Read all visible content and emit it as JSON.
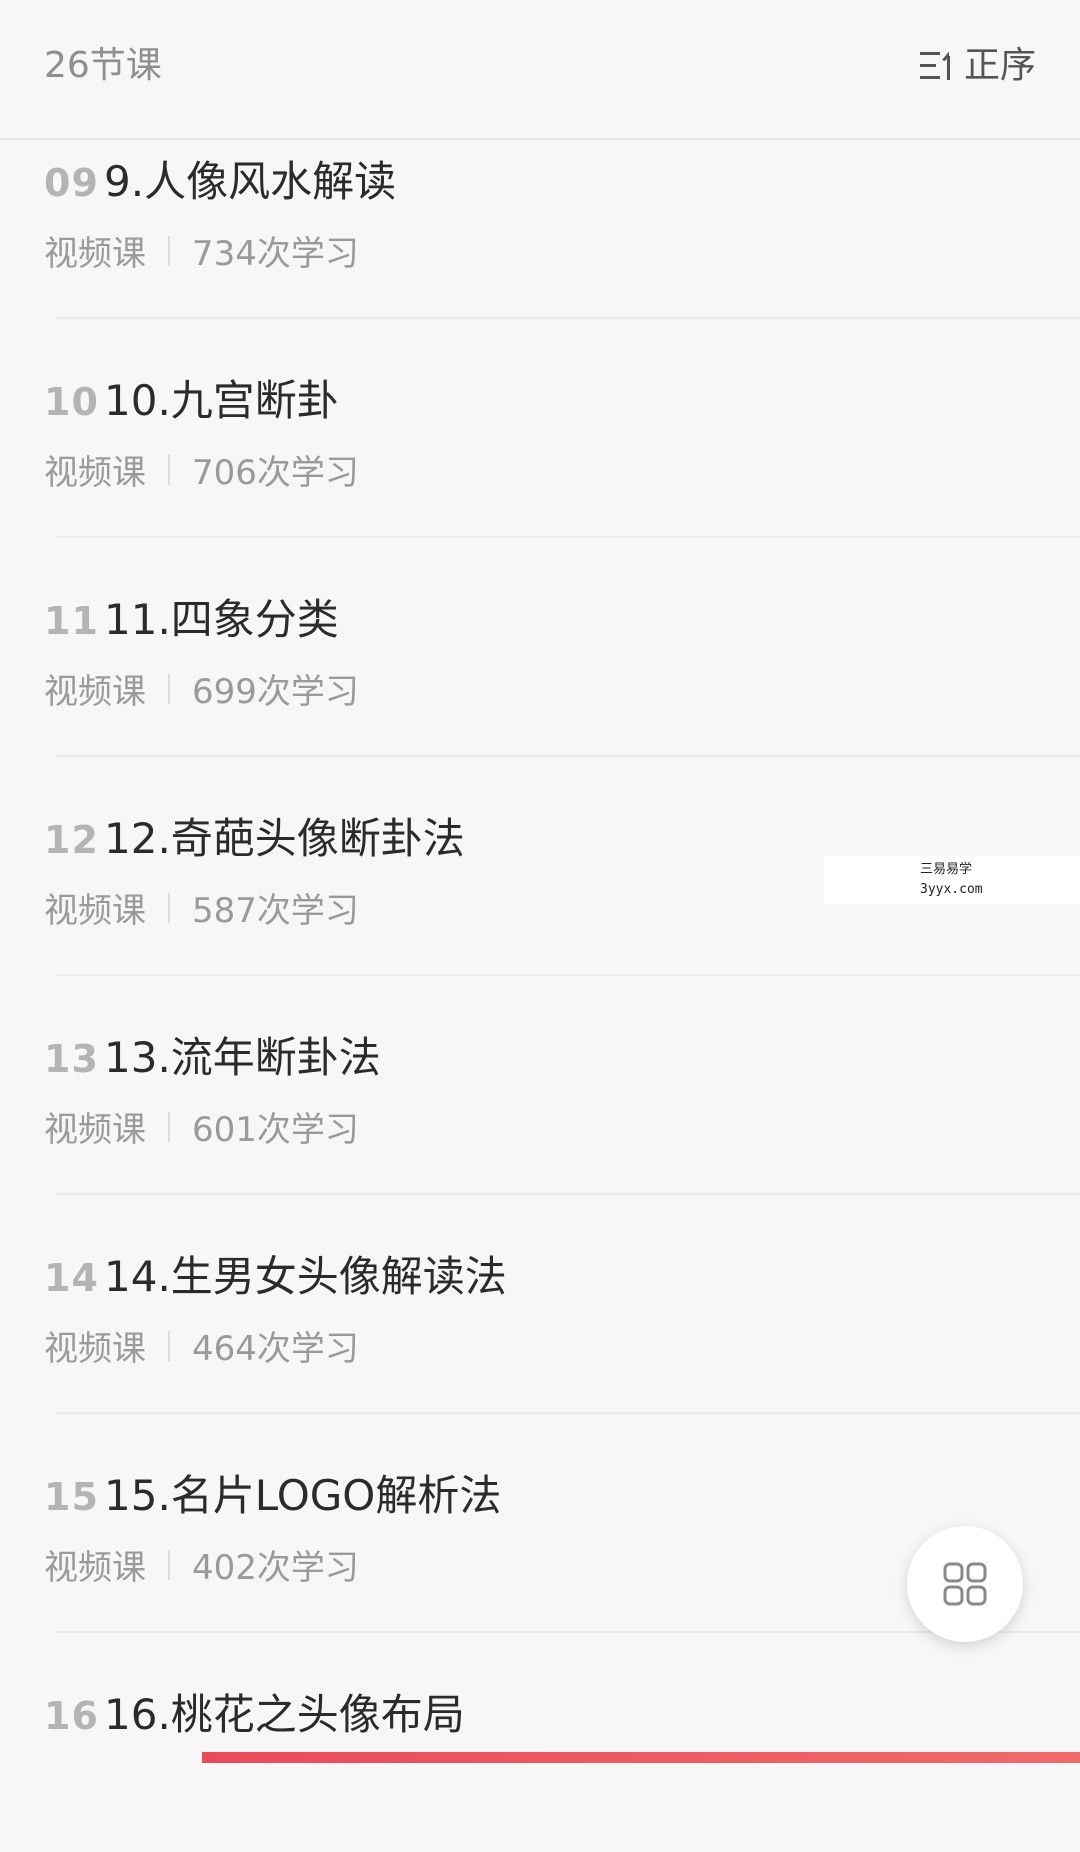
{
  "header": {
    "lesson_count": "26节课",
    "sort_label": "正序",
    "sort_icon": "sort-order-icon"
  },
  "lessons": [
    {
      "num": "09",
      "title": "9.人像风水解读",
      "type": "视频课",
      "views": "734次学习"
    },
    {
      "num": "10",
      "title": "10.九宫断卦",
      "type": "视频课",
      "views": "706次学习"
    },
    {
      "num": "11",
      "title": "11.四象分类",
      "type": "视频课",
      "views": "699次学习"
    },
    {
      "num": "12",
      "title": "12.奇葩头像断卦法",
      "type": "视频课",
      "views": "587次学习"
    },
    {
      "num": "13",
      "title": "13.流年断卦法",
      "type": "视频课",
      "views": "601次学习"
    },
    {
      "num": "14",
      "title": "14.生男女头像解读法",
      "type": "视频课",
      "views": "464次学习"
    },
    {
      "num": "15",
      "title": "15.名片LOGO解析法",
      "type": "视频课",
      "views": "402次学习"
    },
    {
      "num": "16",
      "title": "16.桃花之头像布局",
      "type": "视频课",
      "views": ""
    }
  ],
  "watermark": {
    "line1": "三易易学",
    "line2": "3yyx.com"
  },
  "fab": {
    "icon": "grid-icon"
  },
  "colors": {
    "background": "#f7f7f7",
    "accent_bar": "#e94b59"
  }
}
